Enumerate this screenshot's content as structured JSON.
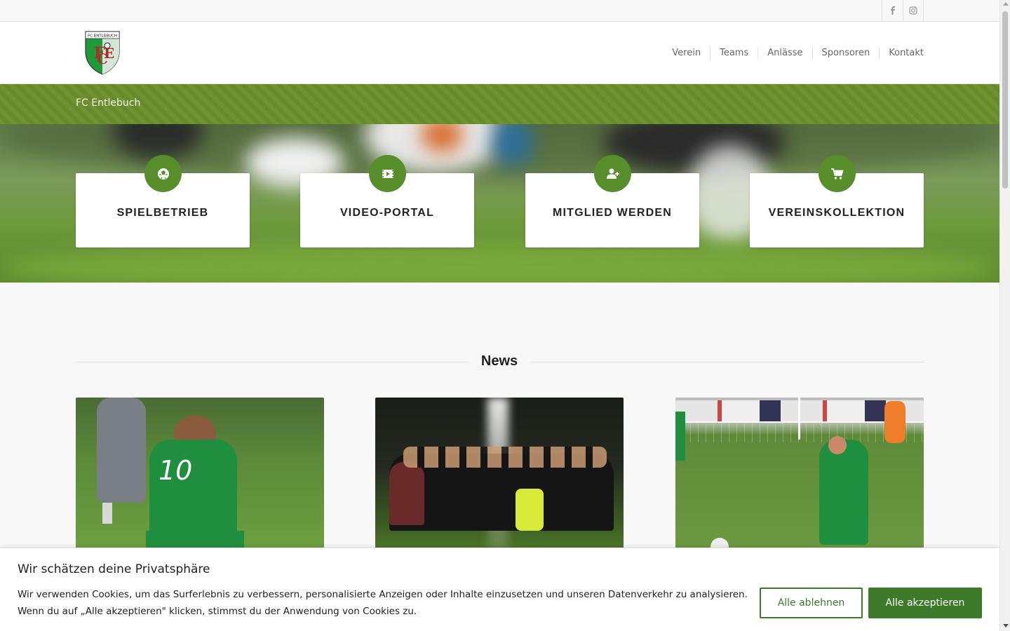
{
  "topbar": {
    "social": [
      {
        "name": "facebook-icon"
      },
      {
        "name": "instagram-icon"
      }
    ]
  },
  "header": {
    "logo_text": "FC ENTLEBUCH",
    "nav": [
      "Verein",
      "Teams",
      "Anlässe",
      "Sponsoren",
      "Kontakt"
    ]
  },
  "titlebar": {
    "title": "FC Entlebuch"
  },
  "hero": {
    "cards": [
      {
        "label": "SPIELBETRIEB",
        "icon": "soccer-ball-icon"
      },
      {
        "label": "VIDEO-PORTAL",
        "icon": "video-icon"
      },
      {
        "label": "MITGLIED WERDEN",
        "icon": "add-user-icon"
      },
      {
        "label": "VEREINSKOLLEKTION",
        "icon": "cart-icon"
      }
    ]
  },
  "news": {
    "heading": "News"
  },
  "cookie": {
    "title": "Wir schätzen deine Privatsphäre",
    "text": "Wir verwenden Cookies, um das Surferlebnis zu verbessern, personalisierte Anzeigen oder Inhalte einzusetzen und unseren Datenverkehr zu analysieren. Wenn du auf „Alle akzeptieren\" klicken, stimmst du der Anwendung von Cookies zu.",
    "reject_label": "Alle ablehnen",
    "accept_label": "Alle akzeptieren"
  },
  "colors": {
    "brand_green": "#6a8f2c",
    "icon_green": "#578e2b",
    "button_green": "#3d7a2a"
  }
}
